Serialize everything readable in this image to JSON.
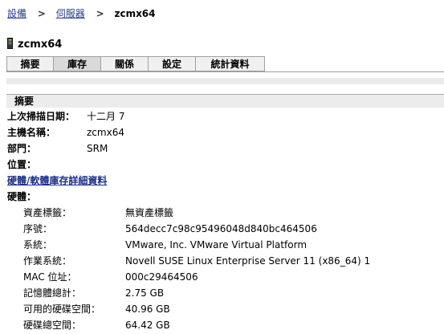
{
  "breadcrumb": {
    "item1": "設備",
    "item2": "伺服器",
    "current": "zcmx64",
    "separator": ">"
  },
  "device": {
    "name": "zcmx64",
    "icon": "server-tower-icon"
  },
  "tabs": [
    {
      "label": "摘要",
      "active": false
    },
    {
      "label": "庫存",
      "active": true
    },
    {
      "label": "關係",
      "active": false
    },
    {
      "label": "設定",
      "active": false
    },
    {
      "label": "統計資料",
      "active": false
    }
  ],
  "summary": {
    "header": "摘要",
    "last_scan_label": "上次掃描日期：",
    "last_scan_value": "十二月 7",
    "hostname_label": "主機名稱：",
    "hostname_value": "zcmx64",
    "department_label": "部門：",
    "department_value": "SRM",
    "location_label": "位置：",
    "inventory_link": "硬體/軟體庫存詳細資料",
    "hardware_label": "硬體："
  },
  "hardware": [
    {
      "label": "資產標籤：",
      "value": "無資產標籤"
    },
    {
      "label": "序號：",
      "value": "564decc7c98c95496048d840bc464506"
    },
    {
      "label": "系統：",
      "value": "VMware, Inc. VMware Virtual Platform"
    },
    {
      "label": "作業系統：",
      "value": "Novell SUSE Linux Enterprise Server 11 (x86_64) 1"
    },
    {
      "label": "MAC 位址：",
      "value": "000c29464506"
    },
    {
      "label": "記憶體總計：",
      "value": "2.75 GB"
    },
    {
      "label": "可用的硬碟空間：",
      "value": "40.96 GB"
    },
    {
      "label": "硬碟總空間：",
      "value": "64.42 GB"
    }
  ],
  "colors": {
    "link": "#2a3c8f",
    "tab_active": "#d9d9d9",
    "tab_inactive": "#f0f0f0",
    "panel_header": "#ececec"
  }
}
